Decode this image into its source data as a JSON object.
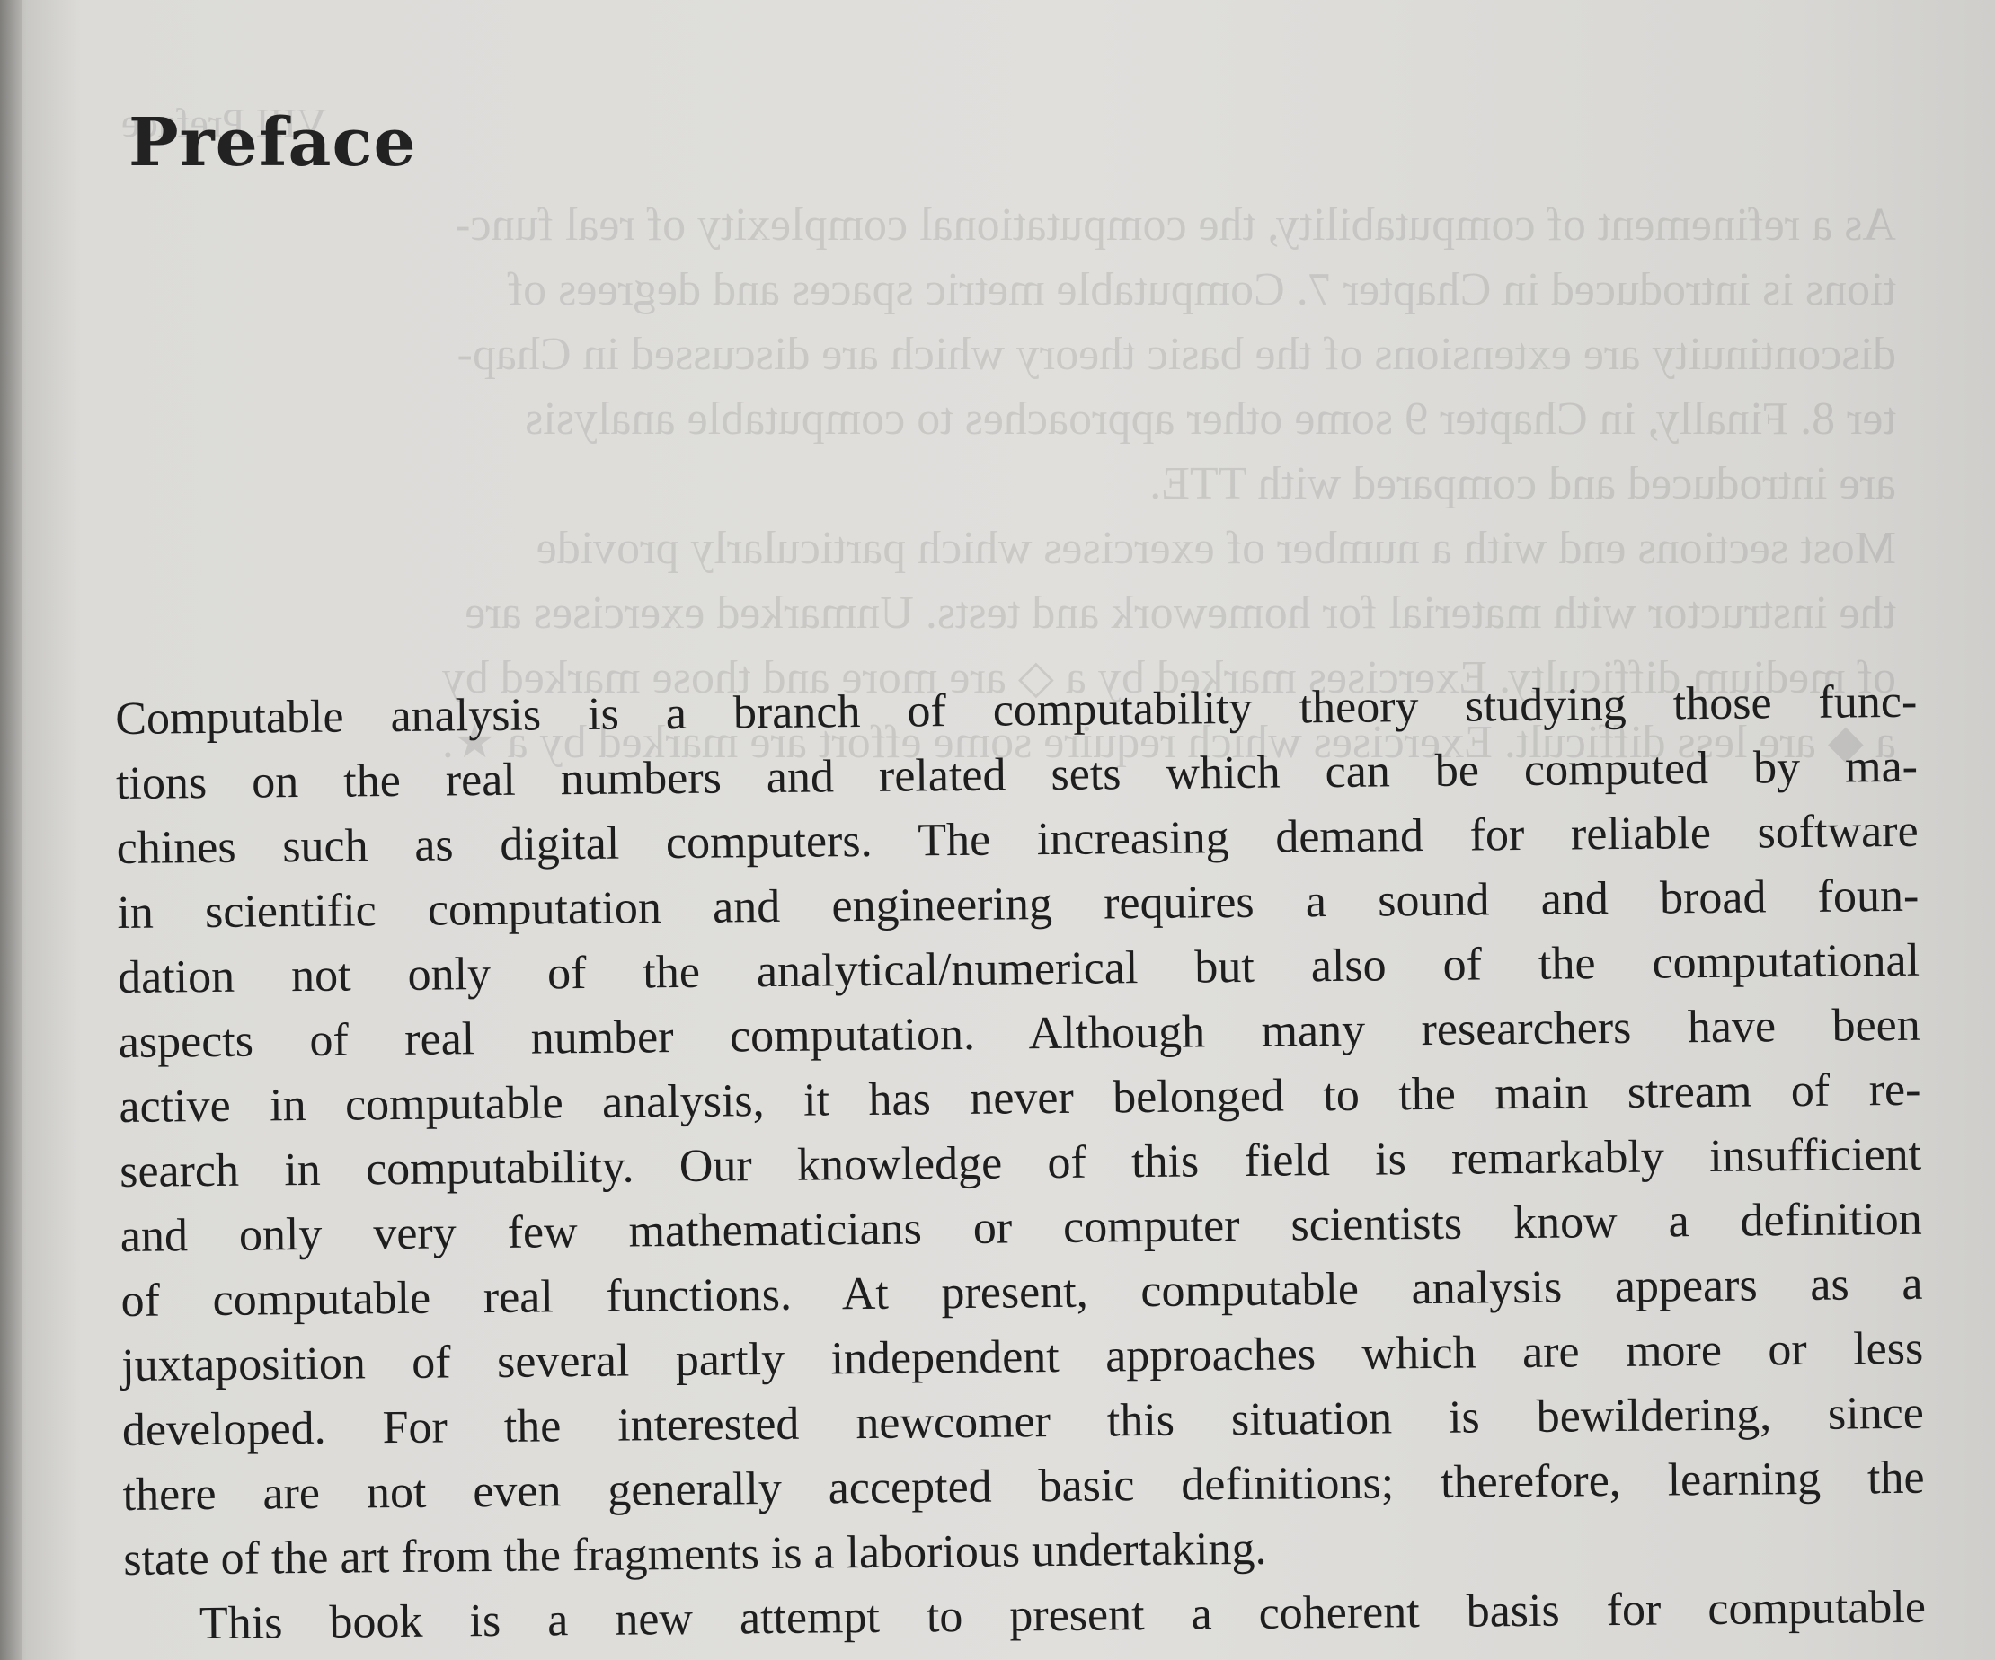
{
  "page": {
    "heading": "Preface"
  },
  "show_through": {
    "header": "VIII Preface",
    "lines": [
      "As a refinement of computability, the computational complexity of real func-",
      "tions is introduced in Chapter 7. Computable metric spaces and degrees of",
      "discontinuity are extensions of the basic theory which are discussed in Chap-",
      "ter 8. Finally, in Chapter 9 some other approaches to computable analysis",
      "are introduced and compared with TTE.",
      "Most sections end with a number of exercises which particularly provide",
      "the instructor with material for homework and tests. Unmarked exercises are",
      "of medium difficulty. Exercises marked by a ◇ are more and those marked by",
      "a ◆ are less difficult. Exercises which require some effort are marked by a ★."
    ]
  },
  "preface": {
    "lines": [
      "Computable analysis is a branch of computability theory studying those func-",
      "tions on the real numbers and related sets which can be computed by ma-",
      "chines such as digital computers. The increasing demand for reliable software",
      "in scientific computation and engineering requires a sound and broad foun-",
      "dation not only of the analytical/numerical but also of the computational",
      "aspects of real number computation. Although many researchers have been",
      "active in computable analysis, it has never belonged to the main stream of re-",
      "search in computability. Our knowledge of this field is remarkably insufficient",
      "and only very few mathematicians or computer scientists know a definition",
      "of computable real functions. At present, computable analysis appears as a",
      "juxtaposition of several partly independent approaches which are more or less",
      "developed. For the interested newcomer this situation is bewildering, since",
      "there are not even generally accepted basic definitions; therefore, learning the",
      "state of the art from the fragments is a laborious undertaking.",
      "This book is a new attempt to present a coherent basis for computable"
    ]
  }
}
